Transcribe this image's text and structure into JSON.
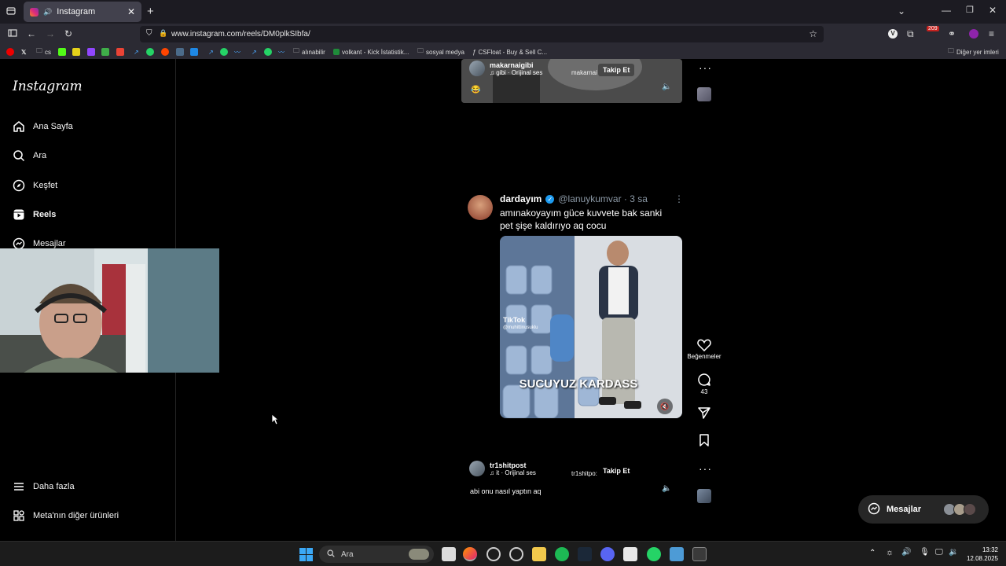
{
  "browser": {
    "tab_title": "Instagram",
    "url": "www.instagram.com/reels/DM0plkSIbfa/",
    "notif_badge": "209",
    "bookmarks": [
      "cs",
      "alınabilir",
      "volkant - Kick İstatistik...",
      "sosyal medya",
      "CSFloat - Buy & Sell C..."
    ],
    "other_bookmarks": "Diğer yer imleri"
  },
  "sidebar": {
    "logo": "Instagram",
    "items": [
      {
        "label": "Ana Sayfa",
        "icon": "home-icon"
      },
      {
        "label": "Ara",
        "icon": "search-icon"
      },
      {
        "label": "Keşfet",
        "icon": "compass-icon"
      },
      {
        "label": "Reels",
        "icon": "reels-icon"
      },
      {
        "label": "Mesajlar",
        "icon": "messenger-icon"
      }
    ],
    "more_label": "Daha fazla",
    "meta_label": "Meta'nın diğer ürünleri"
  },
  "reel_top": {
    "username": "makarnaigibi",
    "audio": "gibi · Orijinal ses",
    "audio_tag": "makarnai",
    "follow_label": "Takip Et"
  },
  "reel_main": {
    "tweet_name": "dardayım",
    "tweet_handle": "@lanuykumvar · 3 sa",
    "tweet_text": "amınakoyayım güce kuvvete bak sanki pet şişe kaldırıyo aq cocu",
    "video_caption": "SUCUYUZ KARDASS",
    "tiktok_brand": "TikTok",
    "tiktok_user": "@muhittinusuklu"
  },
  "actions": {
    "likes_label": "Beğenmeler",
    "comments_count": "43"
  },
  "reel_bottom": {
    "username": "tr1shitpost",
    "audio": "it · Orijinal ses",
    "audio_tag": "tr1shitpo:",
    "follow_label": "Takip Et",
    "caption": "abi onu nasıl yaptın aq"
  },
  "messages_float": {
    "label": "Mesajlar"
  },
  "taskbar": {
    "search_placeholder": "Ara",
    "time": "13:32",
    "date": "12.08.2025"
  },
  "colors": {
    "accent_blue": "#0095f6",
    "verified": "#1d9bf0",
    "spotify": "#1db954",
    "whatsapp": "#25d366"
  }
}
